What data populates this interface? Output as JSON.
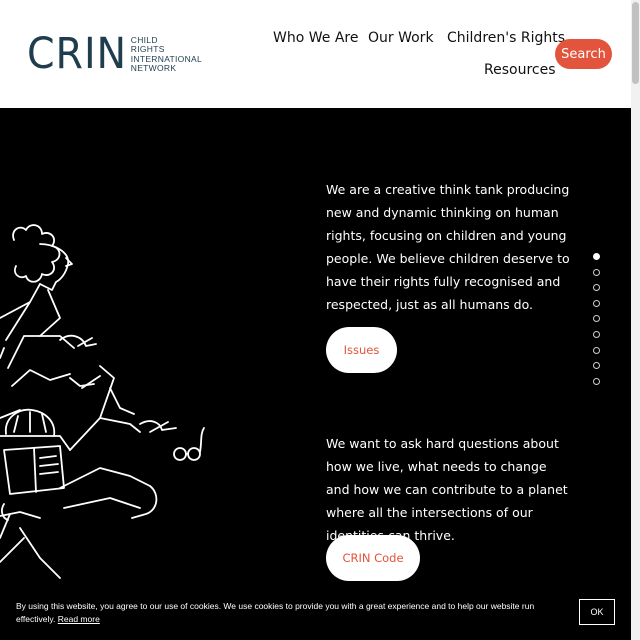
{
  "logo": {
    "mark": "CRIN",
    "lines": [
      "CHILD",
      "RIGHTS",
      "INTERNATIONAL",
      "NETWORK"
    ]
  },
  "nav": {
    "who_we_are": "Who We Are",
    "our_work": "Our Work",
    "childrens_rights": "Children's Rights",
    "resources": "Resources",
    "search": "Search"
  },
  "main": {
    "intro": "We are a creative think tank producing new and dynamic thinking on human rights, focusing on children and young people. We believe children deserve to have their rights fully recognised and respected, just as all humans do.",
    "issues_button": "Issues",
    "questions": "We want to ask hard questions about how we live, what needs to change and how we can contribute to a planet where all the intersections of our identities can thrive.",
    "code_button": "CRIN Code"
  },
  "pagination": {
    "count": 9,
    "active_index": 0
  },
  "cookie": {
    "text": "By using this website, you agree to our use of cookies. We use cookies to provide you with a great experience and to help our website run effectively.",
    "link": "Read more",
    "ok": "OK"
  },
  "colors": {
    "accent": "#e3543c",
    "logo": "#1f3d4d",
    "background": "#000000"
  }
}
